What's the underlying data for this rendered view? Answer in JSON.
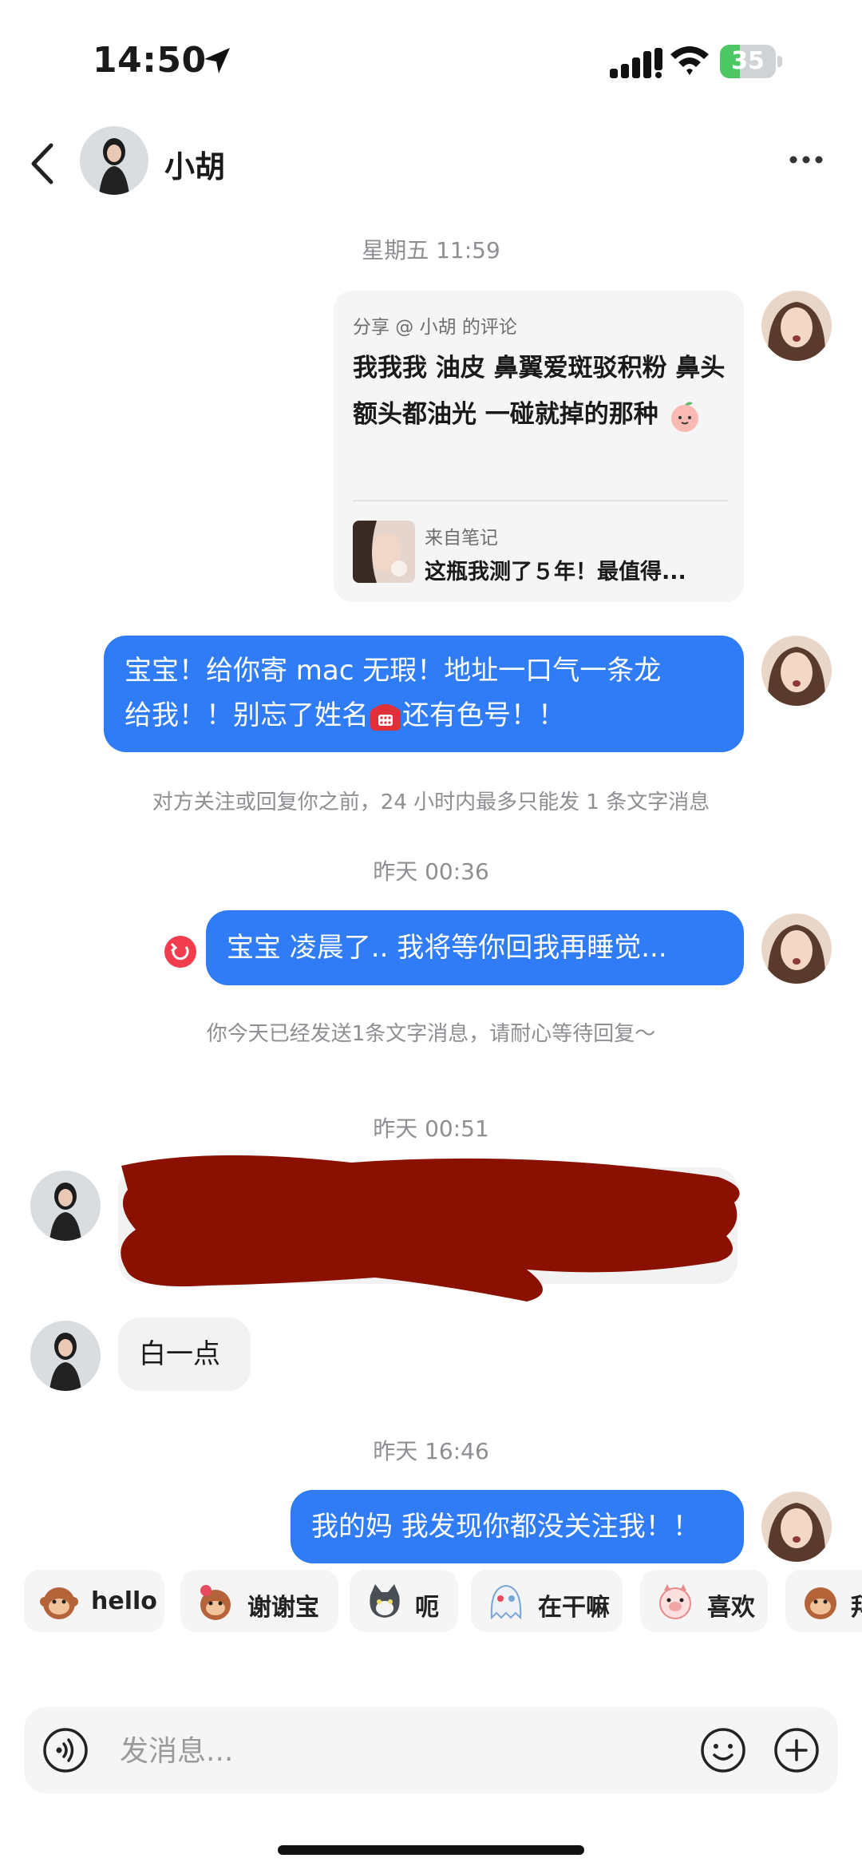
{
  "status": {
    "time": "14:50",
    "battery": "35",
    "battery_level": 0.35
  },
  "header": {
    "name": "小胡"
  },
  "timestamps": {
    "t1": "星期五 11:59",
    "t2": "昨天 00:36",
    "t3": "昨天 00:51",
    "t4": "昨天 16:46"
  },
  "share_card": {
    "source": "分享 @ 小胡 的评论",
    "text": "我我我 油皮 鼻翼爱斑驳积粉 鼻头额头都油光 一碰就掉的那种",
    "note_from": "来自笔记",
    "note_title": "这瓶我测了５年！最值得..."
  },
  "messages": {
    "m1_line1": "宝宝！给你寄 mac 无瑕！地址一口气一条龙",
    "m1_line2a": "给我！！别忘了姓名",
    "m1_line2b": "还有色号！！",
    "notice1": "对方关注或回复你之前，24 小时内最多只能发 1 条文字消息",
    "m2": "宝宝 凌晨了.. 我将等你回我再睡觉...",
    "notice2": "你今天已经发送1条文字消息，请耐心等待回复～",
    "reply2": "白一点",
    "m3": "我的妈 我发现你都没关注我！！"
  },
  "quick_replies": [
    {
      "label": "hello",
      "icon": "monkey-sticker"
    },
    {
      "label": "谢谢宝",
      "icon": "monkey-flower-sticker"
    },
    {
      "label": "呃",
      "icon": "cat-sticker"
    },
    {
      "label": "在干嘛",
      "icon": "ghost-sticker"
    },
    {
      "label": "喜欢",
      "icon": "pig-sticker"
    },
    {
      "label": "拜",
      "icon": "monkey-sticker"
    }
  ],
  "composer": {
    "placeholder": "发消息..."
  },
  "colors": {
    "bubble_me": "#2f7cf6",
    "bubble_them": "#f2f2f2",
    "resend": "#f23d4f",
    "redaction": "#8a1100"
  }
}
